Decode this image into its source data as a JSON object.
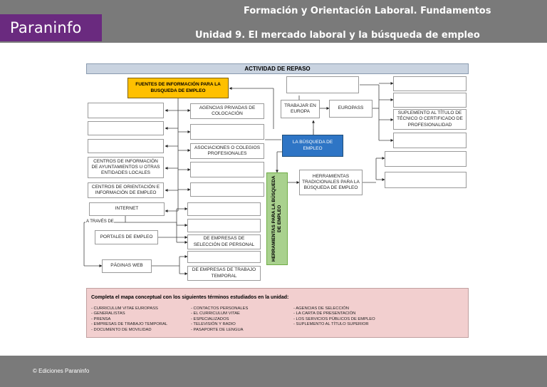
{
  "header": {
    "brand": "Paraninfo",
    "course": "Formación y Orientación Laboral. Fundamentos",
    "unit": "Unidad 9. El mercado laboral y la búsqueda de empleo"
  },
  "footer": {
    "copyright": "© Ediciones Paraninfo"
  },
  "activity": {
    "title": "ACTIVIDAD DE REPASO",
    "center": "LA BÚSQUEDA DE EMPLEO",
    "sources": "FUENTES DE INFORMACIÓN PARA LA BUSQUEDA DE EMPLEO",
    "tools": "HERRAMIENTAS PARA LA BÚSQUEDA DE EMPLEO",
    "left_labels": {
      "agencias": "AGENCIAS PRIVADAS DE COLOCACIÓN",
      "asociaciones": "ASOCIACIONES O COLEGIOS PROFESIONALES",
      "centros_info": "CENTROS DE INFORMACIÓN DE AYUNTAMIENTOS U OTRAS ENTIDADES LOCALES",
      "centros_orient": "CENTROS DE ORIENTACIÓN E INFORMACIÓN DE EMPLEO",
      "internet": "INTERNET",
      "a_traves": "A TRAVÉS DE",
      "portales": "PORTALES DE EMPLEO",
      "paginas": "PÁGINAS WEB",
      "seleccion": "DE EMPRESAS DE SELECCIÓN DE PERSONAL",
      "temporal": "DE EMPRESAS DE TRABAJO TEMPORAL"
    },
    "right_labels": {
      "trabajar": "TRABAJAR EN EUROPA",
      "europass": "EUROPASS",
      "suplemento": "SUPLEMENTO AL TÍTULO DE TÉCNICO O CERTIFICADO DE PROFESIONALIDAD",
      "tradicionales": "HERRAMIENTAS TRADICIONALES PARA LA BÚSQUEDA DE EMPLEO"
    },
    "instructions": "Completa el mapa conceptual con los siguientes términos estudiados en la unidad:",
    "terms_col1": [
      "- CURRICULUM VITAE EUROPASS",
      "- GENERALISTAS",
      "- PRENSA",
      "- EMPRESAS DE TRABAJO TEMPORAL",
      "- DOCUMENTO DE MOVILIDAD"
    ],
    "terms_col2": [
      "- CONTACTOS PERSONALES",
      "- EL CURRICULUM VITAE",
      "- ESPECIALIZADOS",
      "- TELEVISIÓN Y RADIO",
      "- PASAPORTE DE LENGUA"
    ],
    "terms_col3": [
      "- AGENCIAS DE SELECCIÓN",
      "- LA CARTA DE PRESENTACIÓN",
      "- LOS SERVICIOS PÚBLICOS DE EMPLEO",
      "- SUPLEMENTO AL TÍTULO SUPERIOR"
    ]
  }
}
